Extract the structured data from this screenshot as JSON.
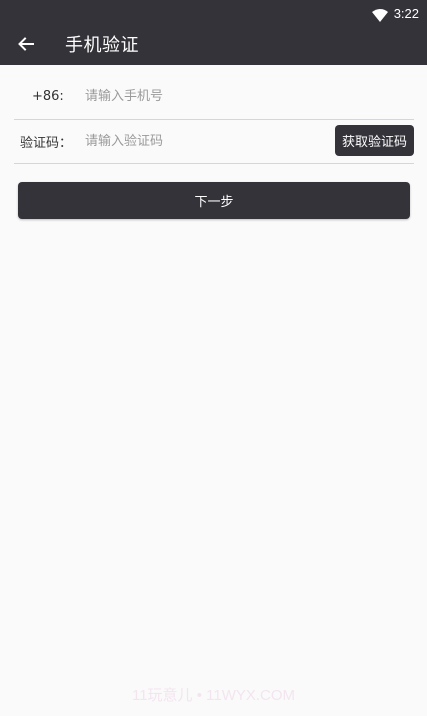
{
  "status_bar": {
    "time": "3:22",
    "wifi_icon": "wifi-icon"
  },
  "app_bar": {
    "back_icon": "arrow-back-icon",
    "title": "手机验证"
  },
  "form": {
    "phone": {
      "prefix": "+86:",
      "value": "",
      "placeholder": "请输入手机号"
    },
    "code": {
      "label": "验证码：",
      "value": "",
      "placeholder": "请输入验证码",
      "get_code_button": "获取验证码"
    }
  },
  "next_button": "下一步",
  "watermark": "11玩意儿 • 11WYX.COM",
  "colors": {
    "primary_dark": "#333339",
    "background": "#fafafa",
    "divider": "#d6d6d6",
    "placeholder": "#9a9a9a"
  }
}
